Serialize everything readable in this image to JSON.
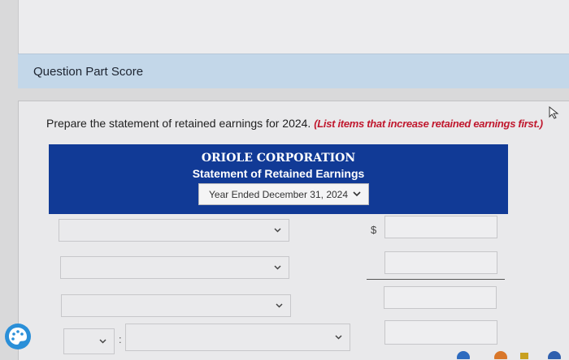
{
  "score_bar": {
    "label": "Question Part Score"
  },
  "question": {
    "instruction": "Prepare the statement of retained earnings for 2024.",
    "instruction_emphasis": "(List items that increase retained earnings first.)"
  },
  "statement": {
    "company": "ORIOLE CORPORATION",
    "title": "Statement of Retained Earnings",
    "period_selected": "Year Ended December 31, 2024"
  },
  "rows": {
    "currency_symbol": "$",
    "separator": ":"
  },
  "colors": {
    "header_bg": "#113a96",
    "score_bar_bg": "#c3d7e9",
    "emphasis_red": "#c0182e"
  },
  "icons": [
    "cursor-icon",
    "chevron-down-icon",
    "palette-icon"
  ]
}
